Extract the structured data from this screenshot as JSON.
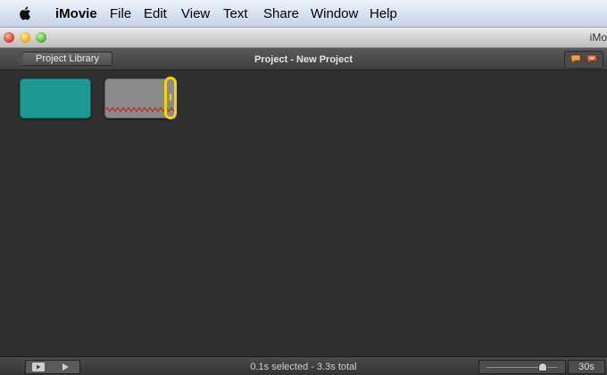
{
  "menubar": {
    "app_name": "iMovie",
    "items": [
      "File",
      "Edit",
      "View",
      "Text",
      "Share",
      "Window",
      "Help"
    ]
  },
  "window": {
    "title": "iMo"
  },
  "toolbar": {
    "back_label": "Project Library",
    "project_title": "Project - New Project"
  },
  "timeline": {
    "clips": [
      {
        "kind": "transition",
        "color": "#1a9891"
      },
      {
        "kind": "video",
        "color": "#8a8a8a",
        "audio_color": "#c0282d",
        "selected": true
      }
    ],
    "selection_color": "#f2d400"
  },
  "status": {
    "text": "0.1s selected - 3.3s total",
    "zoom_level": 0.83,
    "duration_label": "30s"
  },
  "icons": {
    "apple": "apple-logo-icon",
    "comment": "comment-marker-icon",
    "chapter": "chapter-marker-icon",
    "play": "play-icon",
    "play_fullscreen": "play-fullscreen-icon"
  }
}
